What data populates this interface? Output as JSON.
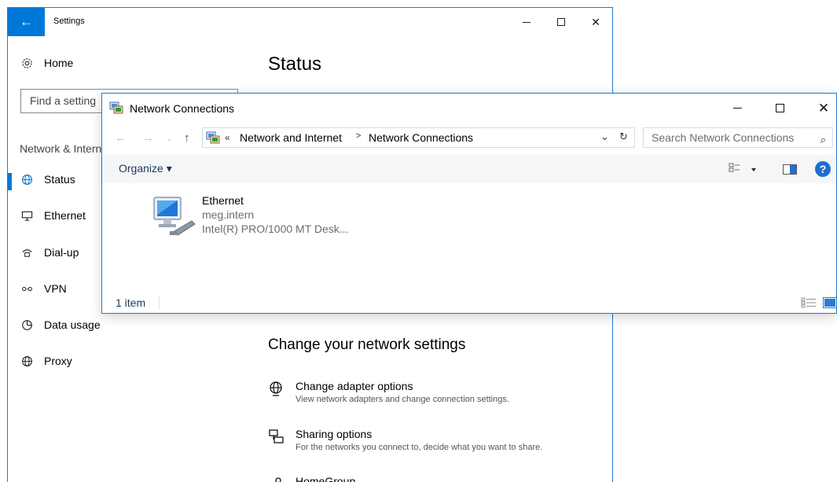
{
  "settings": {
    "window_title": "Settings",
    "back_glyph": "←",
    "close_glyph": "✕",
    "home_label": "Home",
    "search_placeholder": "Find a setting",
    "section_label": "Network & Internet",
    "nav": [
      {
        "label": "Status",
        "icon": "globe-icon"
      },
      {
        "label": "Ethernet",
        "icon": "ethernet-icon"
      },
      {
        "label": "Dial-up",
        "icon": "dialup-icon"
      },
      {
        "label": "VPN",
        "icon": "vpn-icon"
      },
      {
        "label": "Data usage",
        "icon": "data-usage-icon"
      },
      {
        "label": "Proxy",
        "icon": "proxy-globe-icon"
      }
    ],
    "page_heading": "Status",
    "change_heading": "Change your network settings",
    "options": [
      {
        "title": "Change adapter options",
        "desc": "View network adapters and change connection settings.",
        "icon": "adapter-globe-icon"
      },
      {
        "title": "Sharing options",
        "desc": "For the networks you connect to, decide what you want to share.",
        "icon": "sharing-icon"
      },
      {
        "title": "HomeGroup",
        "icon": "homegroup-icon"
      }
    ]
  },
  "network_connections": {
    "window_title": "Network Connections",
    "address": {
      "prefix": "«",
      "crumbs": [
        "Network and Internet",
        "Network Connections"
      ]
    },
    "search_placeholder": "Search Network Connections",
    "organize_label": "Organize ▾",
    "help_glyph": "?",
    "adapter": {
      "name": "Ethernet",
      "network": "meg.intern",
      "device": "Intel(R) PRO/1000 MT Desk..."
    },
    "status_count": "1 item"
  },
  "colors": {
    "accent": "#0078d7",
    "link": "#1e395b"
  }
}
